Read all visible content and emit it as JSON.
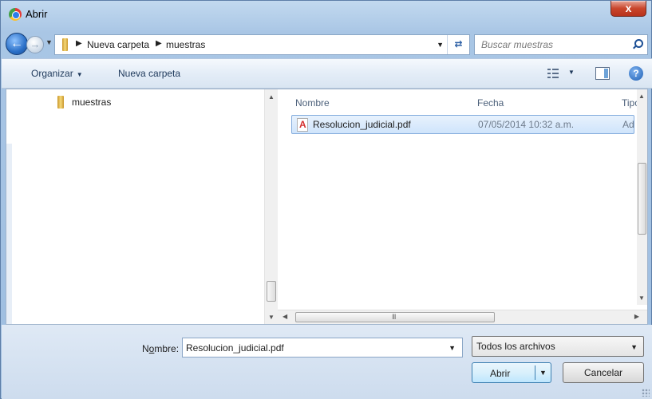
{
  "window": {
    "title": "Abrir",
    "close_label": "x"
  },
  "nav": {
    "breadcrumb": [
      "Nueva carpeta",
      "muestras"
    ],
    "search_placeholder": "Buscar muestras"
  },
  "toolbar": {
    "organize_label": "Organizar",
    "new_folder_label": "Nueva carpeta",
    "help_label": "?"
  },
  "sidebar": {
    "items": [
      {
        "label": "muestras",
        "icon": "folder-icon"
      }
    ]
  },
  "file_list": {
    "columns": [
      "Nombre",
      "Fecha",
      "Tipo"
    ],
    "rows": [
      {
        "name": "Resolucion_judicial.pdf",
        "date": "07/05/2014 10:32 a.m.",
        "type": "Ado",
        "icon": "pdf-icon",
        "selected": true
      }
    ],
    "hscroll_grip": "III"
  },
  "footer": {
    "name_label_pre": "N",
    "name_label_underlined": "o",
    "name_label_post": "mbre:",
    "name_value": "Resolucion_judicial.pdf",
    "file_type_filter": "Todos los archivos",
    "open_label": "Abrir",
    "cancel_label": "Cancelar"
  },
  "colors": {
    "frame": "#a9c6e5",
    "selection": "#cfe4fb",
    "close_button": "#c9462c",
    "link_text": "#1e395b"
  }
}
